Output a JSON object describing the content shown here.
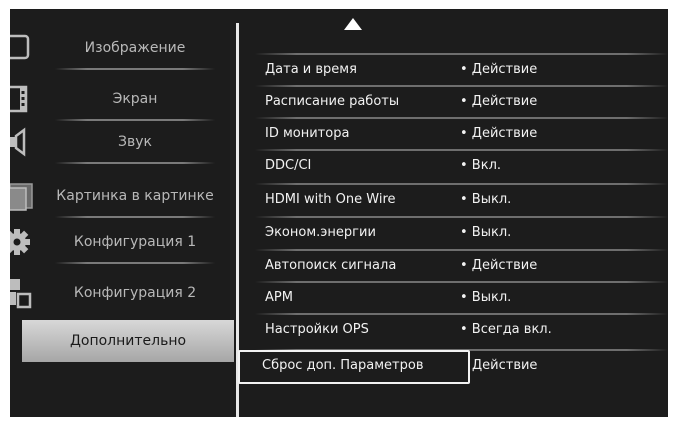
{
  "sidebar": {
    "items": [
      {
        "label": "Изображение",
        "icon": "picture-icon"
      },
      {
        "label": "Экран",
        "icon": "film-screen-icon"
      },
      {
        "label": "Звук",
        "icon": "speaker-icon"
      },
      {
        "label": "Картинка в картинке",
        "icon": "pip-icon"
      },
      {
        "label": "Конфигурация 1",
        "icon": "gear-icon"
      },
      {
        "label": "Конфигурация 2",
        "icon": "blocks-icon"
      },
      {
        "label": "Дополнительно",
        "icon": "none",
        "active": true
      }
    ]
  },
  "settings": {
    "rows": [
      {
        "name": "Дата и время",
        "value": "• Действие"
      },
      {
        "name": "Расписание работы",
        "value": "• Действие"
      },
      {
        "name": "ID монитора",
        "value": "• Действие"
      },
      {
        "name": "DDC/CI",
        "value": "• Вкл."
      },
      {
        "name": "HDMI with One Wire",
        "value": "• Выкл."
      },
      {
        "name": "Эконом.энергии",
        "value": "• Выкл."
      },
      {
        "name": "Автопоиск сигнала",
        "value": "• Действие"
      },
      {
        "name": "APM",
        "value": "• Выкл."
      },
      {
        "name": "Настройки OPS",
        "value": "• Всегда вкл."
      },
      {
        "name": "Сброс доп. Параметров",
        "value": "Действие",
        "selected": true
      }
    ]
  },
  "colors": {
    "background": "#1c1c1c",
    "text": "#f2f2f2",
    "active_item": "#c8c8c8"
  }
}
